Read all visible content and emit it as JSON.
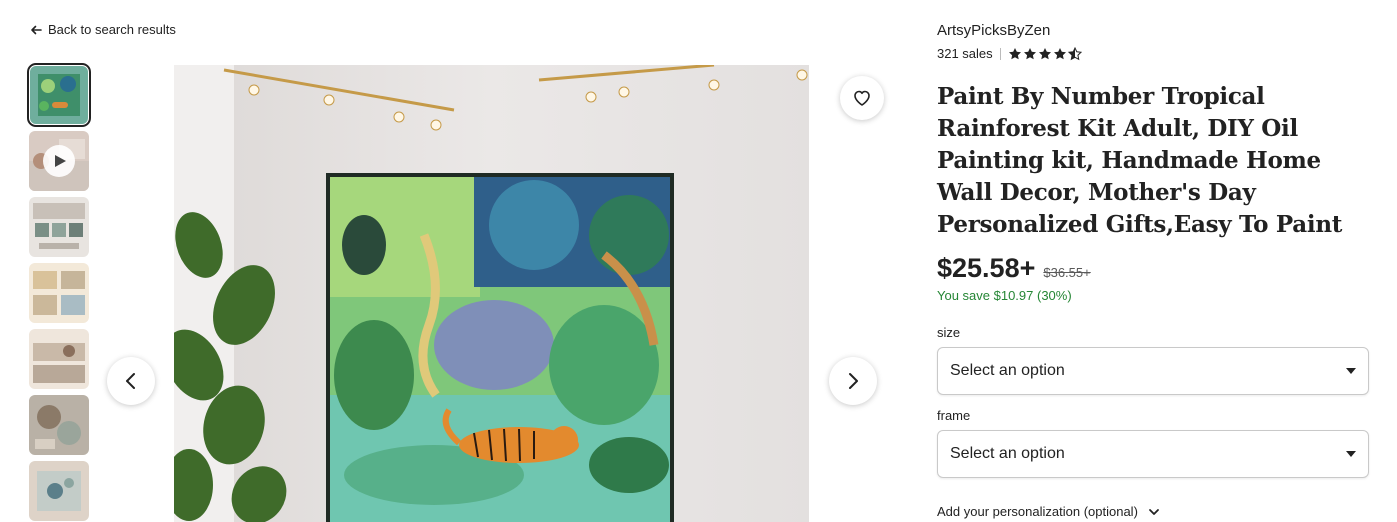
{
  "nav": {
    "back_label": "Back to search results"
  },
  "gallery": {
    "thumbnails": [
      {
        "name": "thumb-tiger-painting",
        "active": true
      },
      {
        "name": "thumb-video",
        "video": true
      },
      {
        "name": "thumb-kit-contents"
      },
      {
        "name": "thumb-steps-1"
      },
      {
        "name": "thumb-steps-2"
      },
      {
        "name": "thumb-painting-hands"
      },
      {
        "name": "thumb-painting-detail"
      }
    ],
    "prev_icon": "chevron-left-icon",
    "next_icon": "chevron-right-icon",
    "favorite_icon": "heart-icon"
  },
  "shop": {
    "name": "ArtsyPicksByZen",
    "sales": "321 sales",
    "rating": 4.5
  },
  "product": {
    "title": "Paint By Number Tropical Rainforest Kit Adult, DIY Oil Painting kit, Handmade Home Wall Decor, Mother's Day Personalized Gifts,Easy To Paint",
    "price": "$25.58+",
    "original_price": "$36.55+",
    "savings": "You save $10.97 (30%)"
  },
  "options": {
    "size_label": "size",
    "size_value": "Select an option",
    "frame_label": "frame",
    "frame_value": "Select an option"
  },
  "personalization": {
    "label": "Add your personalization (optional)"
  },
  "colors": {
    "savings": "#258635",
    "text": "#222222"
  }
}
